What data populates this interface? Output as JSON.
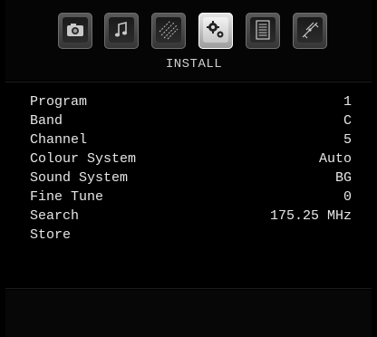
{
  "menu": {
    "title": "INSTALL",
    "tabs": [
      {
        "icon": "camera-icon",
        "active": false
      },
      {
        "icon": "music-note-icon",
        "active": false
      },
      {
        "icon": "sparkle-icon",
        "active": false
      },
      {
        "icon": "gear-icon",
        "active": true
      },
      {
        "icon": "document-icon",
        "active": false
      },
      {
        "icon": "satellite-icon",
        "active": false
      }
    ],
    "items": [
      {
        "label": "Program",
        "value": "1"
      },
      {
        "label": "Band",
        "value": "C"
      },
      {
        "label": "Channel",
        "value": "5"
      },
      {
        "label": "Colour System",
        "value": "Auto"
      },
      {
        "label": "Sound System",
        "value": "BG"
      },
      {
        "label": "Fine Tune",
        "value": "0"
      },
      {
        "label": "Search",
        "value": "175.25 MHz"
      },
      {
        "label": "Store",
        "value": ""
      }
    ]
  },
  "colors": {
    "background": "#000000",
    "text": "#e6e6e6",
    "active_tab": "#dcdcdc",
    "inactive_tab": "#4a4a4a"
  }
}
